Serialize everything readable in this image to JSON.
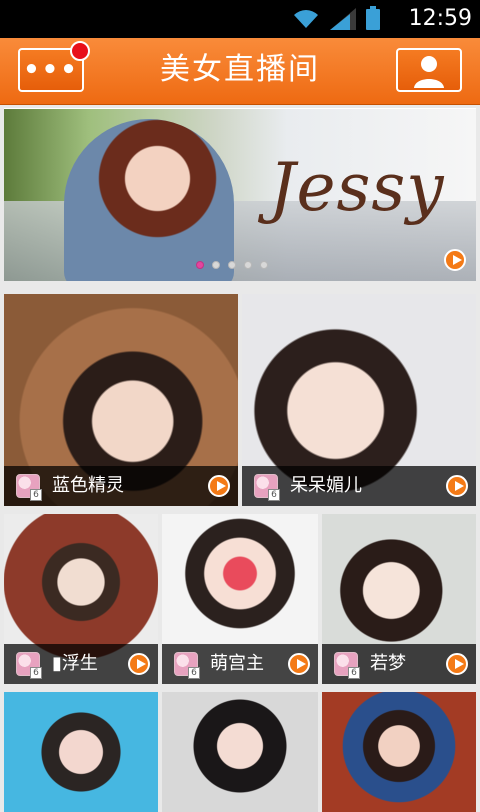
{
  "status_bar": {
    "time": "12:59",
    "icons": [
      "wifi-icon",
      "signal-icon",
      "battery-icon"
    ]
  },
  "header": {
    "title": "美女直播间",
    "menu_icon": "more-dots-icon",
    "profile_icon": "user-icon"
  },
  "banner": {
    "text": "Jessy",
    "slides": 5,
    "active_slide": 1
  },
  "cards": [
    {
      "name": "蓝色精灵"
    },
    {
      "name": "呆呆媚儿"
    },
    {
      "name": "▮浮生"
    },
    {
      "name": "萌宫主"
    },
    {
      "name": "若梦"
    },
    {
      "name": ""
    },
    {
      "name": ""
    },
    {
      "name": ""
    }
  ],
  "colors": {
    "accent": "#f47a16",
    "header": "#ee6a12",
    "badge": "#e8101a",
    "active_dot": "#e4459e"
  }
}
